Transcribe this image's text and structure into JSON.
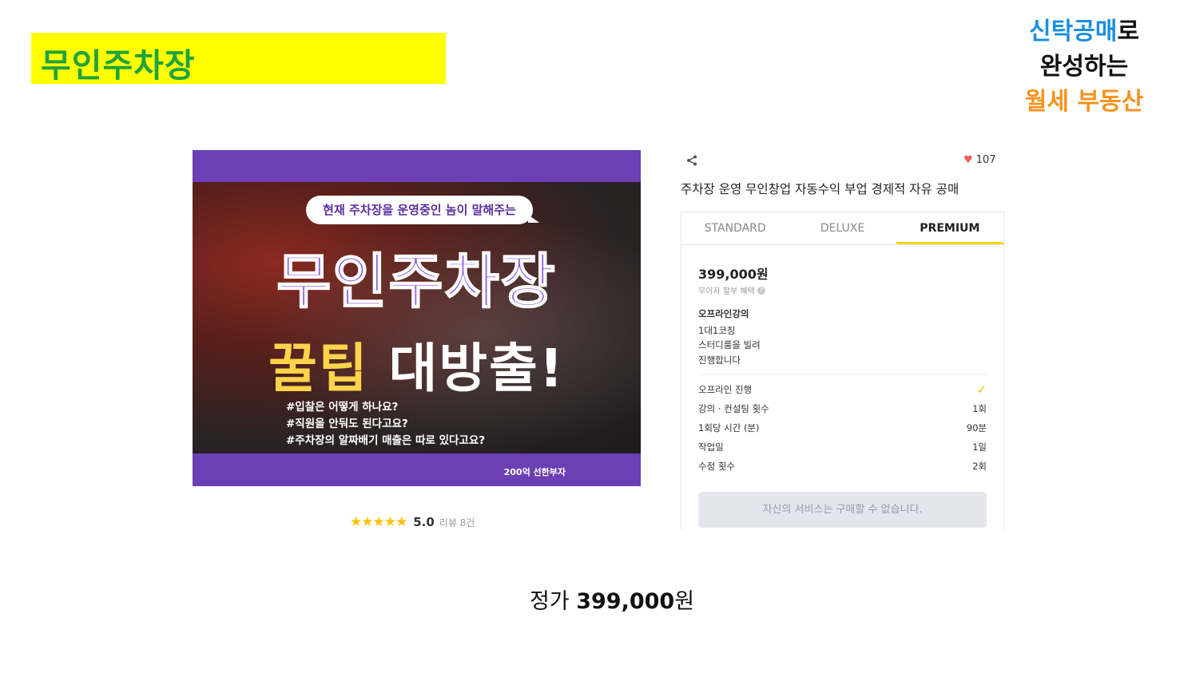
{
  "slide": {
    "title": "무인주차장",
    "brand": {
      "line1_a": "신탁공매",
      "line1_b": "로",
      "line2": "완성하는",
      "line3": "월세 부동산"
    },
    "bottom_price_label": "정가",
    "bottom_price_value": "399,000",
    "bottom_price_unit": "원"
  },
  "thumbnail": {
    "bubble": "현재 주차장을 운영중인 놈이 말해주는",
    "headline1": "무인주차장",
    "headline2_a": "꿀팁",
    "headline2_b": "대방출!",
    "tags": [
      "#입찰은 어떻게 하나요?",
      "#직원을 안둬도 된다고요?",
      "#주차장의 알짜배기 매출은 따로 있다고요?"
    ],
    "credit": "200억 선한부자"
  },
  "rating": {
    "stars": "★★★★★",
    "score": "5.0",
    "reviews": "리뷰 8건"
  },
  "product": {
    "likes": "107",
    "title": "주차장 운영 무인창업 자동수익 부업 경제적 자유 공매",
    "tabs": [
      {
        "label": "STANDARD",
        "active": false
      },
      {
        "label": "DELUXE",
        "active": false
      },
      {
        "label": "PREMIUM",
        "active": true
      }
    ],
    "price": "399,000원",
    "installment": "무이자 할부 혜택",
    "desc_heading": "오프라인강의",
    "desc_lines": [
      "1대1코칭",
      "스터디룸을 빌려",
      "진행합니다"
    ],
    "rows": [
      {
        "label": "오프라인 진행",
        "value": "✓"
      },
      {
        "label": "강의 · 컨설팅 횟수",
        "value": "1회"
      },
      {
        "label": "1회당 시간 (분)",
        "value": "90분"
      },
      {
        "label": "작업일",
        "value": "1일"
      },
      {
        "label": "수정 횟수",
        "value": "2회"
      }
    ],
    "buy_button": "자신의 서비스는 구매할 수 없습니다."
  },
  "colors": {
    "title_bg": "#ffff00",
    "title_text": "#1fa33d",
    "brand_blue": "#1a8fe0",
    "brand_orange": "#f7931e",
    "thumb_purple": "#6c3fb5",
    "tab_active": "#ffd400",
    "check": "#f2c200"
  },
  "icons": {
    "share": "share-icon",
    "like": "heart-icon",
    "info": "info-icon",
    "check": "check-icon",
    "star": "star-icon"
  }
}
